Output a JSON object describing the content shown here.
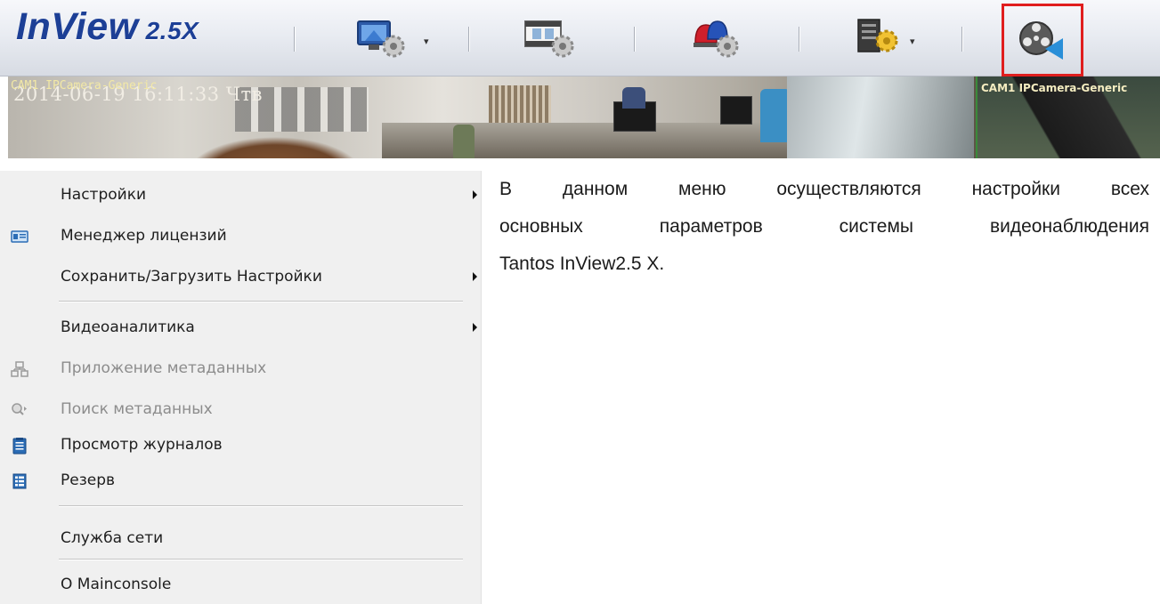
{
  "app": {
    "logo_name": "InView",
    "logo_version": "2.5X"
  },
  "toolbar": {
    "buttons": [
      {
        "name": "display-settings-button",
        "icon": "monitor-gear-icon",
        "has_dropdown": true
      },
      {
        "name": "record-settings-button",
        "icon": "film-gear-icon",
        "has_dropdown": false
      },
      {
        "name": "alarm-settings-button",
        "icon": "siren-gear-icon",
        "has_dropdown": false
      },
      {
        "name": "system-settings-button",
        "icon": "server-gear-icon",
        "has_dropdown": true
      },
      {
        "name": "playback-button",
        "icon": "film-reel-icon",
        "has_dropdown": false,
        "highlighted": true
      }
    ],
    "highlight_color": "#e01e1e"
  },
  "video": {
    "main_label": "CAM1 IPCamera-Generic",
    "main_timestamp": "2014-06-19 16:11:33 Чтв",
    "side_label": "CAM1 IPCamera-Generic"
  },
  "menu": {
    "items": [
      {
        "label": "Настройки",
        "icon": null,
        "submenu": true,
        "disabled": false
      },
      {
        "label": "Менеджер лицензий",
        "icon": "license-card-icon",
        "submenu": false,
        "disabled": false
      },
      {
        "label": "Сохранить/Загрузить Настройки",
        "icon": null,
        "submenu": true,
        "disabled": false
      },
      {
        "label": "Видеоаналитика",
        "icon": null,
        "submenu": true,
        "disabled": false
      },
      {
        "label": "Приложение метаданных",
        "icon": "metadata-app-icon",
        "submenu": false,
        "disabled": true
      },
      {
        "label": "Поиск метаданных",
        "icon": "metadata-search-icon",
        "submenu": false,
        "disabled": true
      },
      {
        "label": "Просмотр журналов",
        "icon": "log-clipboard-icon",
        "submenu": false,
        "disabled": false
      },
      {
        "label": "Резерв",
        "icon": "backup-list-icon",
        "submenu": false,
        "disabled": false
      },
      {
        "label": "Служба сети",
        "icon": null,
        "submenu": false,
        "disabled": false
      },
      {
        "label": "О Mainconsole",
        "icon": null,
        "submenu": false,
        "disabled": false
      }
    ]
  },
  "description": {
    "line1": "В данном меню осуществляются настройки всех",
    "line2": "основных параметров системы видеонаблюдения",
    "line3": "Tantos InView2.5 X."
  }
}
